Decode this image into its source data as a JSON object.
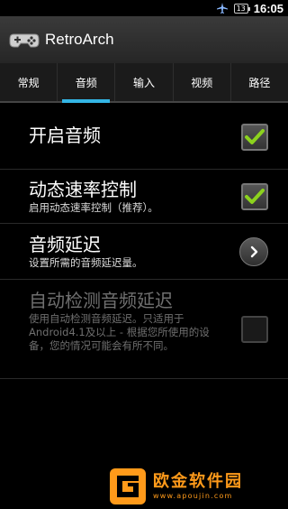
{
  "status_bar": {
    "battery": "13",
    "time": "16:05",
    "icons": [
      "airplane-icon",
      "battery-icon"
    ]
  },
  "app": {
    "title": "RetroArch",
    "icon": "gamepad-icon"
  },
  "tabs": [
    {
      "label": "常规",
      "active": false
    },
    {
      "label": "音频",
      "active": true
    },
    {
      "label": "输入",
      "active": false
    },
    {
      "label": "视频",
      "active": false
    },
    {
      "label": "路径",
      "active": false
    }
  ],
  "settings": [
    {
      "title": "开启音频",
      "summary": "",
      "widget": "checkbox",
      "checked": true,
      "enabled": true
    },
    {
      "title": "动态速率控制",
      "summary": "启用动态速率控制（推荐）。",
      "widget": "checkbox",
      "checked": true,
      "enabled": true
    },
    {
      "title": "音频延迟",
      "summary": "设置所需的音频延迟量。",
      "widget": "chevron",
      "enabled": true
    },
    {
      "title": "自动检测音频延迟",
      "summary": "使用自动检测音频延迟。只适用于Android4.1及以上 - 根据您所使用的设备，您的情况可能会有所不同。",
      "widget": "checkbox",
      "checked": false,
      "enabled": false
    }
  ],
  "watermark": {
    "text": "欧金软件园",
    "url": "www.apoujin.com"
  },
  "colors": {
    "accent": "#33b5e5",
    "check": "#8cd21e",
    "watermark": "#ff9a1a"
  }
}
